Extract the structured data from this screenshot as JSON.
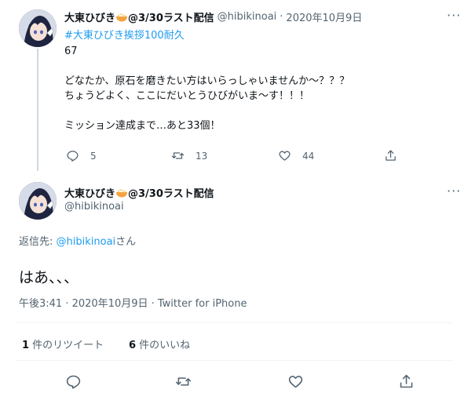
{
  "tweet1": {
    "display_name": "大東ひびき",
    "name_suffix": "@3/30ラスト配信",
    "handle": "@hibikinoai",
    "separator": "·",
    "date": "2020年10月9日",
    "hashtag": "#大東ひびき挨拶100耐久",
    "body": "67\n\nどなたか、原石を磨きたい方はいらっしゃいませんか～？？？\nちょうどよく、ここにだいとうひびがいま～す！！！\n\nミッション達成まで…あと33個！",
    "reply_count": "5",
    "retweet_count": "13",
    "like_count": "44",
    "more_label": "···"
  },
  "tweet2": {
    "display_name": "大東ひびき",
    "name_suffix": "@3/30ラスト配信",
    "handle": "@hibikinoai",
    "more_label": "···",
    "reply_to_prefix": "返信先: ",
    "reply_to_handle": "@hibikinoai",
    "reply_to_suffix": "さん",
    "body": "はあ、、、",
    "timestamp": "午後3:41 · 2020年10月9日 · Twitter for iPhone",
    "retweets_num": "1",
    "retweets_label": " 件のリツイート",
    "likes_num": "6",
    "likes_label": " 件のいいね"
  },
  "icons": {
    "reply": "reply-icon",
    "retweet": "retweet-icon",
    "like": "heart-icon",
    "share": "share-icon",
    "bowl": "ramen-bowl-emoji"
  },
  "colors": {
    "link": "#1d9bf0",
    "muted": "#536471",
    "text": "#0f1419"
  }
}
